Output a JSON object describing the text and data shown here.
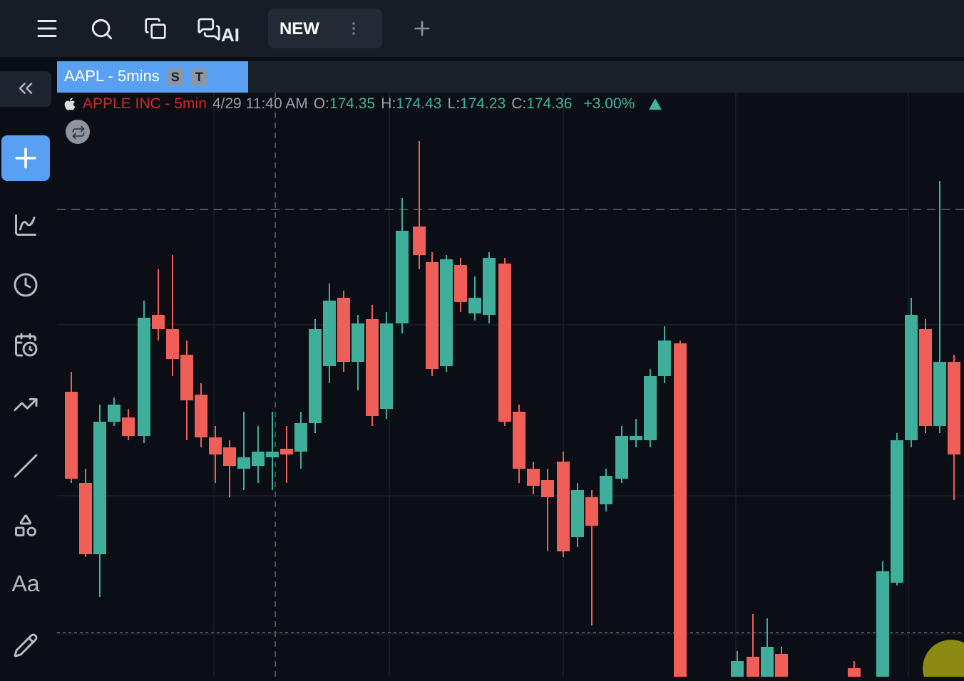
{
  "toolbar": {
    "ai_label": "AI",
    "tabs": [
      {
        "label": "NEW",
        "selected": true
      }
    ]
  },
  "sidebar": {
    "tools": [
      {
        "kind": "add",
        "selected": true
      },
      {
        "kind": "indicator",
        "selected": false
      },
      {
        "kind": "clock",
        "selected": false
      },
      {
        "kind": "calendar",
        "selected": false
      },
      {
        "kind": "trend",
        "selected": false
      },
      {
        "kind": "line",
        "selected": false
      },
      {
        "kind": "shapes",
        "selected": false
      },
      {
        "kind": "text",
        "label": "Aa",
        "selected": false
      },
      {
        "kind": "pencil",
        "selected": false
      }
    ]
  },
  "chart_tab": {
    "label": "AAPL - 5mins",
    "badges": [
      "S",
      "T"
    ]
  },
  "legend": {
    "symbol": "APPLE INC - 5min",
    "datetime": "4/29 11:40 AM",
    "fields": [
      {
        "label": "O:",
        "value": "174.35"
      },
      {
        "label": "H:",
        "value": "174.43"
      },
      {
        "label": "L:",
        "value": "174.23"
      },
      {
        "label": "C:",
        "value": "174.36"
      }
    ],
    "change": "+3.00%"
  }
}
